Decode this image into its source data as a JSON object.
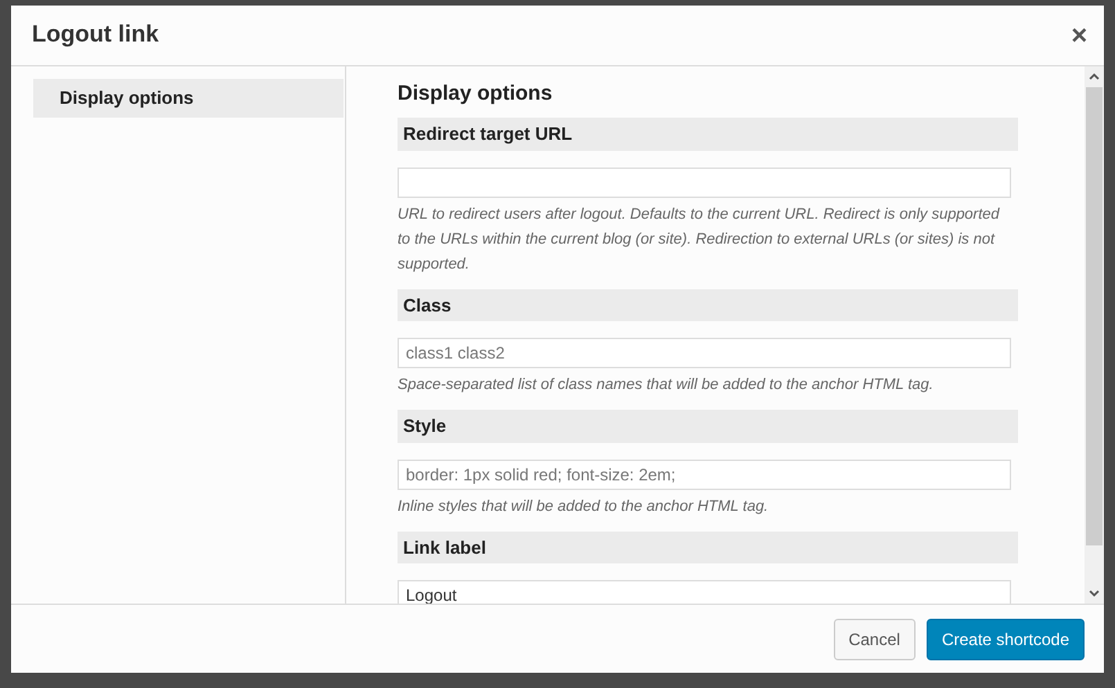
{
  "dialog": {
    "title": "Logout link",
    "close": "×"
  },
  "sidebar": {
    "items": [
      {
        "label": "Display options",
        "selected": true
      }
    ]
  },
  "panel": {
    "heading": "Display options",
    "fields": [
      {
        "label": "Redirect target URL",
        "help": "URL to redirect users after logout. Defaults to the current URL. Redirect is only supported to the URLs within the current blog (or site). Redirection to external URLs (or sites) is not supported."
      },
      {
        "label": "Class",
        "placeholder": "class1 class2",
        "help": "Space-separated list of class names that will be added to the anchor HTML tag."
      },
      {
        "label": "Style",
        "placeholder": "border: 1px solid red; font-size: 2em;",
        "help": "Inline styles that will be added to the anchor HTML tag."
      },
      {
        "label": "Link label",
        "value": "Logout"
      }
    ]
  },
  "buttons": [
    {
      "label": "Cancel",
      "kind": "secondary"
    },
    {
      "label": "Create shortcode",
      "kind": "primary"
    }
  ]
}
